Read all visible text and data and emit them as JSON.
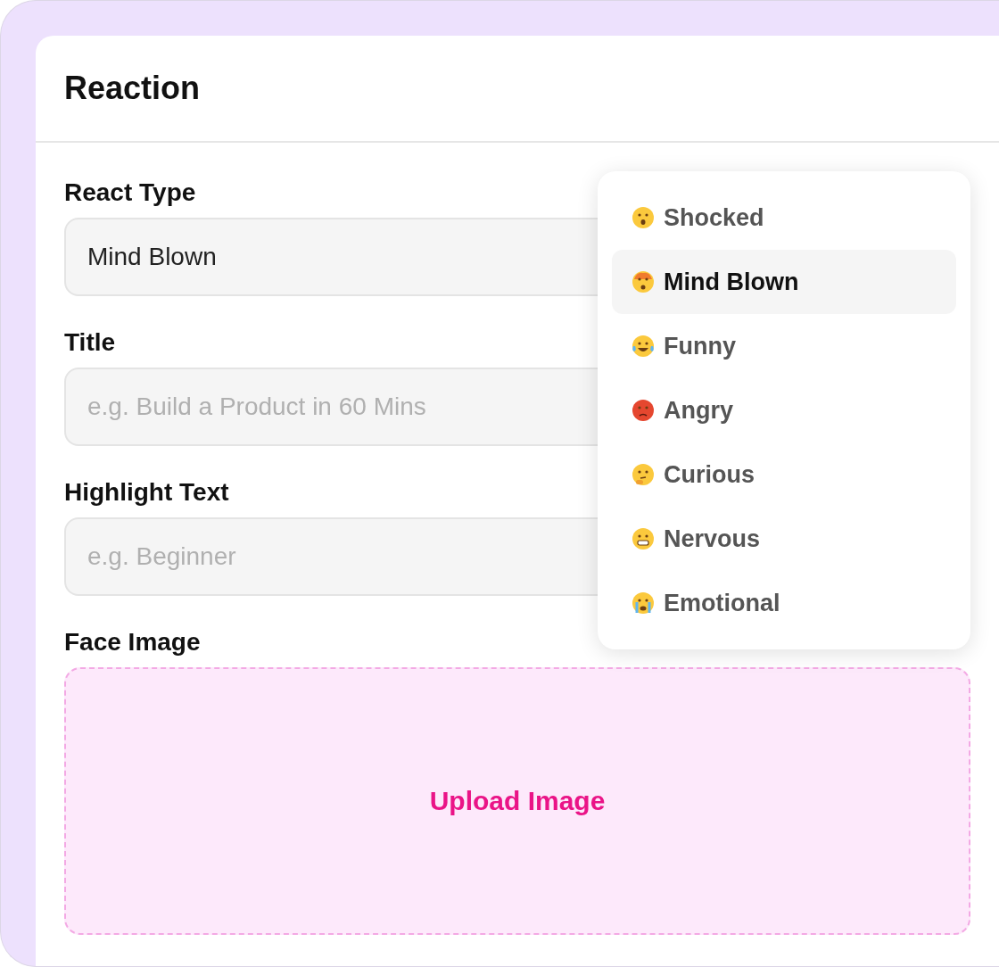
{
  "card": {
    "title": "Reaction"
  },
  "fields": [
    {
      "label": "React Type",
      "value": "Mind Blown"
    },
    {
      "label": "Title",
      "placeholder": "e.g. Build a Product in 60 Mins"
    },
    {
      "label": "Highlight Text",
      "placeholder": "e.g. Beginner"
    }
  ],
  "upload": {
    "label": "Face Image",
    "button": "Upload Image"
  },
  "dropdown": {
    "options": [
      {
        "label": "Shocked",
        "kind": "shocked",
        "selected": false
      },
      {
        "label": "Mind Blown",
        "kind": "mindblown",
        "selected": true
      },
      {
        "label": "Funny",
        "kind": "funny",
        "selected": false
      },
      {
        "label": "Angry",
        "kind": "angry",
        "selected": false
      },
      {
        "label": "Curious",
        "kind": "curious",
        "selected": false
      },
      {
        "label": "Nervous",
        "kind": "nervous",
        "selected": false
      },
      {
        "label": "Emotional",
        "kind": "emotional",
        "selected": false
      }
    ]
  }
}
